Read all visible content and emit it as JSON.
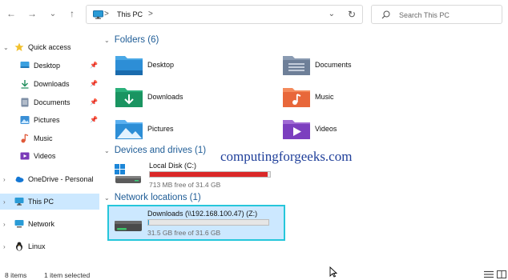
{
  "address": {
    "crumb": "This PC",
    "separator": ">"
  },
  "nav_buttons": {
    "back": "←",
    "forward": "→",
    "recent": "⌄",
    "up": "↑"
  },
  "search": {
    "placeholder": "Search This PC"
  },
  "sidebar": {
    "items": [
      {
        "label": "Quick access",
        "icon": "star-icon"
      },
      {
        "label": "Desktop",
        "icon": "desktop-folder-icon",
        "pinned": true
      },
      {
        "label": "Downloads",
        "icon": "download-icon",
        "pinned": true
      },
      {
        "label": "Documents",
        "icon": "documents-icon",
        "pinned": true
      },
      {
        "label": "Pictures",
        "icon": "pictures-icon",
        "pinned": true
      },
      {
        "label": "Music",
        "icon": "music-icon"
      },
      {
        "label": "Videos",
        "icon": "videos-icon"
      },
      {
        "label": "OneDrive - Personal",
        "icon": "onedrive-icon"
      },
      {
        "label": "This PC",
        "icon": "pc-icon",
        "selected": true
      },
      {
        "label": "Network",
        "icon": "network-icon"
      },
      {
        "label": "Linux",
        "icon": "linux-icon"
      }
    ]
  },
  "groups": {
    "folders": "Folders (6)",
    "devices": "Devices and drives (1)",
    "network": "Network locations (1)"
  },
  "folders": [
    {
      "name": "Desktop",
      "icon": "desktop-folder-icon"
    },
    {
      "name": "Documents",
      "icon": "documents-folder-icon"
    },
    {
      "name": "Downloads",
      "icon": "downloads-folder-icon"
    },
    {
      "name": "Music",
      "icon": "music-folder-icon"
    },
    {
      "name": "Pictures",
      "icon": "pictures-folder-icon"
    },
    {
      "name": "Videos",
      "icon": "videos-folder-icon"
    }
  ],
  "drives": [
    {
      "name": "Local Disk (C:)",
      "free_text": "713 MB free of 31.4 GB",
      "used_fraction": 0.978,
      "bar_color": "#da2828"
    },
    {
      "name": "Downloads (\\\\192.168.100.47) (Z:)",
      "free_text": "31.5 GB free of 31.6 GB",
      "used_fraction": 0.003,
      "bar_color": "#26a0da"
    }
  ],
  "watermark": "computingforgeeks.com",
  "status": {
    "items": "8 items",
    "selected": "1 item selected"
  },
  "colors": {
    "accent": "#1e5c96",
    "selection": "#cce8ff",
    "highlight_border": "#26c6da"
  }
}
